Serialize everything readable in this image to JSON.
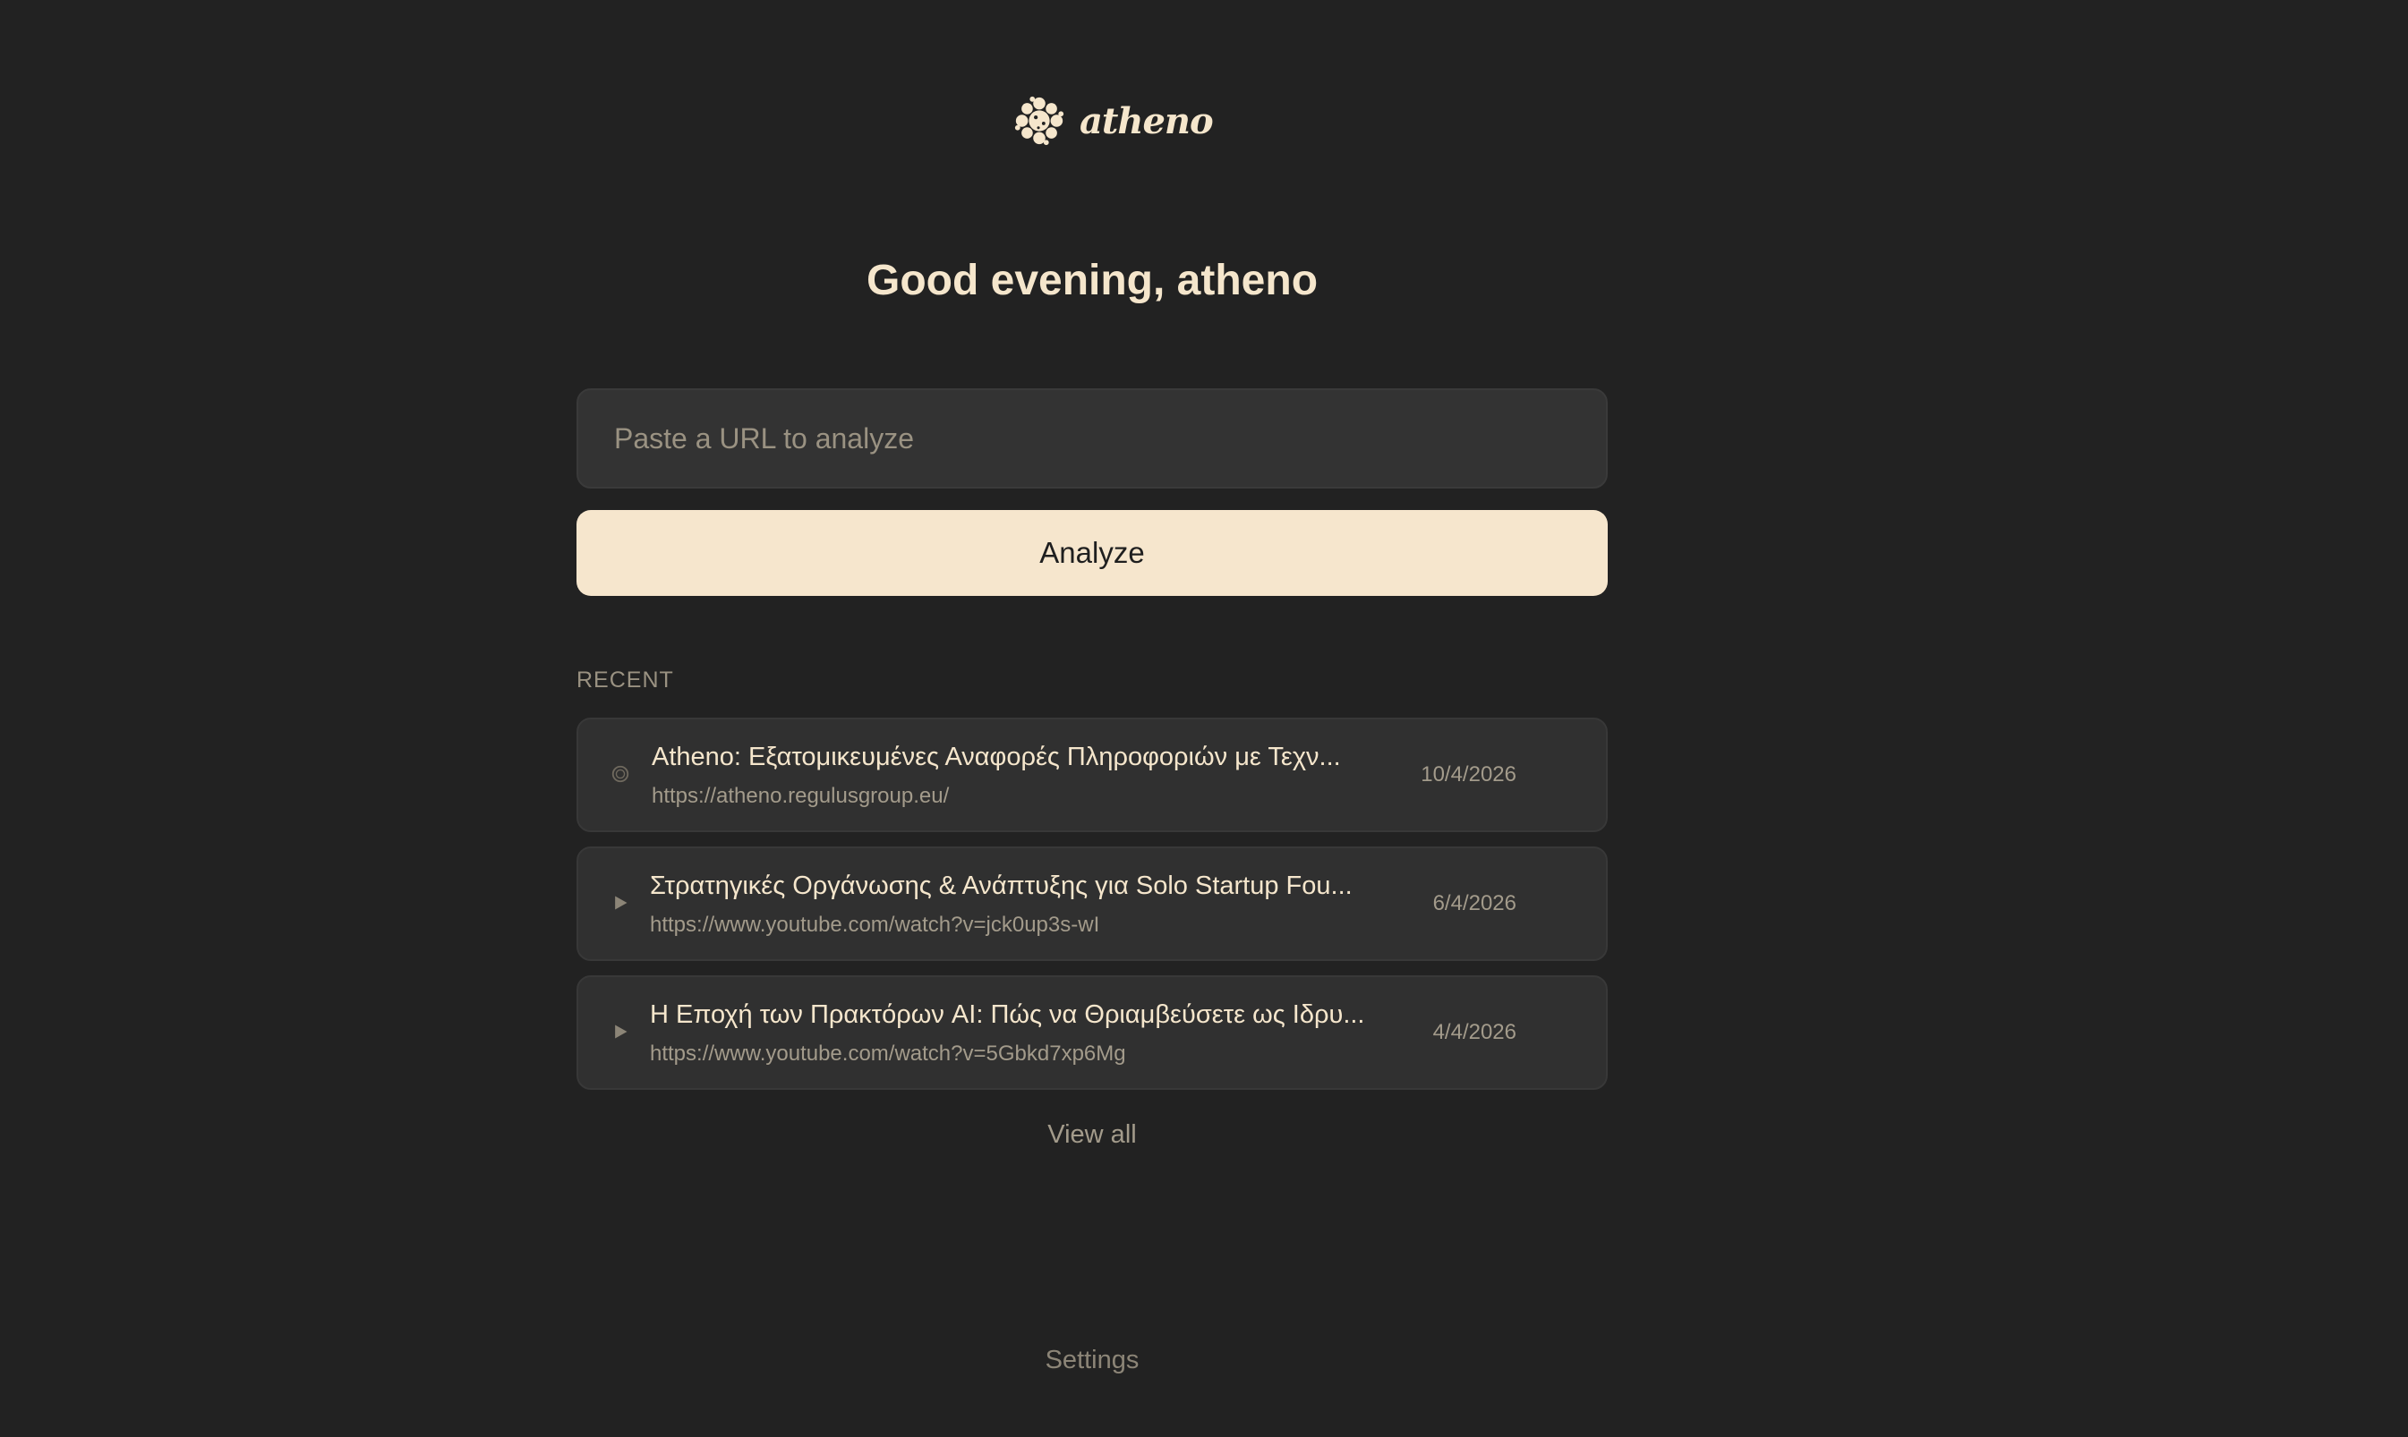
{
  "brand": {
    "name": "atheno",
    "icon": "atheno-logo-icon"
  },
  "greeting": "Good evening, atheno",
  "search": {
    "placeholder": "Paste a URL to analyze",
    "value": ""
  },
  "analyze_button": {
    "label": "Analyze"
  },
  "recent": {
    "heading": "RECENT",
    "items": [
      {
        "title": "Atheno: Εξατομικευμένες Αναφορές Πληροφοριών με Τεχν...",
        "url": "https://atheno.regulusgroup.eu/",
        "date": "10/4/2026",
        "icon": "globe-icon"
      },
      {
        "title": "Στρατηγικές Οργάνωσης & Ανάπτυξης για Solo Startup Fou...",
        "url": "https://www.youtube.com/watch?v=jck0up3s-wI",
        "date": "6/4/2026",
        "icon": "play-icon"
      },
      {
        "title": "Η Εποχή των Πρακτόρων AI: Πώς να Θριαμβεύσετε ως Ιδρυ...",
        "url": "https://www.youtube.com/watch?v=5Gbkd7xp6Mg",
        "date": "4/4/2026",
        "icon": "play-icon"
      }
    ],
    "view_all": "View all"
  },
  "footer": {
    "settings": "Settings"
  },
  "colors": {
    "background": "#222222",
    "accent": "#f6e6cd",
    "text": "#f5e6cc",
    "muted": "#a39b8b"
  }
}
